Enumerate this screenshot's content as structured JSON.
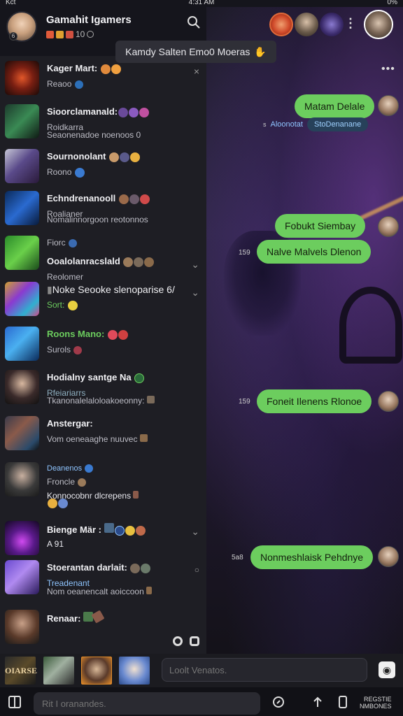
{
  "status": {
    "left": "Kct",
    "center": "4:31 AM",
    "right": "0%"
  },
  "header": {
    "group_title": "Gamahit Igamers",
    "group_sub_count": "10",
    "banner_text": "Kamdy Salten Emo0 Moeras"
  },
  "sidebar": {
    "items": [
      {
        "name": "Kager Mart:",
        "line2": "Reaoo",
        "line3": ""
      },
      {
        "name": "Sioorclamanald:",
        "line2": "Roidkarra",
        "line3": "Seaonenadoe noenoos 0"
      },
      {
        "name": "Sournonolant",
        "line2": "Roono",
        "line3": ""
      },
      {
        "name": "Echndrenanooll",
        "line2": "Roalianer",
        "line3": "Nomalinnorgoon reotonnos"
      },
      {
        "name": "Fiorc",
        "line2": "",
        "line3": ""
      },
      {
        "name": "Ooalolanracslald",
        "line2": "Reolomer",
        "line3": ""
      },
      {
        "name": "Noke Seooke slenoparise 6/",
        "line2": "Sort:",
        "line3": ""
      },
      {
        "name": "Roons Mano:",
        "line2": "Surols",
        "line3": ""
      },
      {
        "name": "Hodialny santge Na",
        "line2": "Rfeiariarrs",
        "line3": "Tkanonalelaloloakoeonny:"
      },
      {
        "name": "Anstergar:",
        "line2": "Vom oeneaaghe nuuvec",
        "line3": ""
      },
      {
        "name": "Deanenos",
        "line2": "Froncle",
        "line3": "Konnocobnr dlcrepens"
      },
      {
        "name": "Bienge Mär :",
        "line2": "A 91",
        "line3": ""
      },
      {
        "name": "Stoerantan darlait:",
        "line2": "Treadenant",
        "line3": "Nom oeanencalt aoiccoon"
      },
      {
        "name": "Renaar:",
        "line2": "",
        "line3": ""
      }
    ]
  },
  "chat": {
    "messages": [
      {
        "text": "Matam Delale",
        "time": ""
      },
      {
        "text": "Fobukt Siembay",
        "time": ""
      },
      {
        "text": "Nalve Malvels Dlenon",
        "time": "159"
      },
      {
        "text": "Foneit Ilenens Rlonoe",
        "time": "159"
      },
      {
        "text": "Nonmeshlaisk Pehdnye",
        "time": "5a8"
      }
    ],
    "system_label": "Aloonotat",
    "system_pill": "StoDenanane"
  },
  "composer": {
    "placeholder": "Loolt Venatos.",
    "tray_first_label": "OIARSE"
  },
  "bottom": {
    "search_placeholder": "Rit I oranandes.",
    "label_top": "REGSTIE",
    "label_bottom": "NMBONES"
  },
  "colors": {
    "accent_green": "#6ccd5e",
    "sidebar_bg": "#1e1e24",
    "header_bg": "#15151c"
  }
}
